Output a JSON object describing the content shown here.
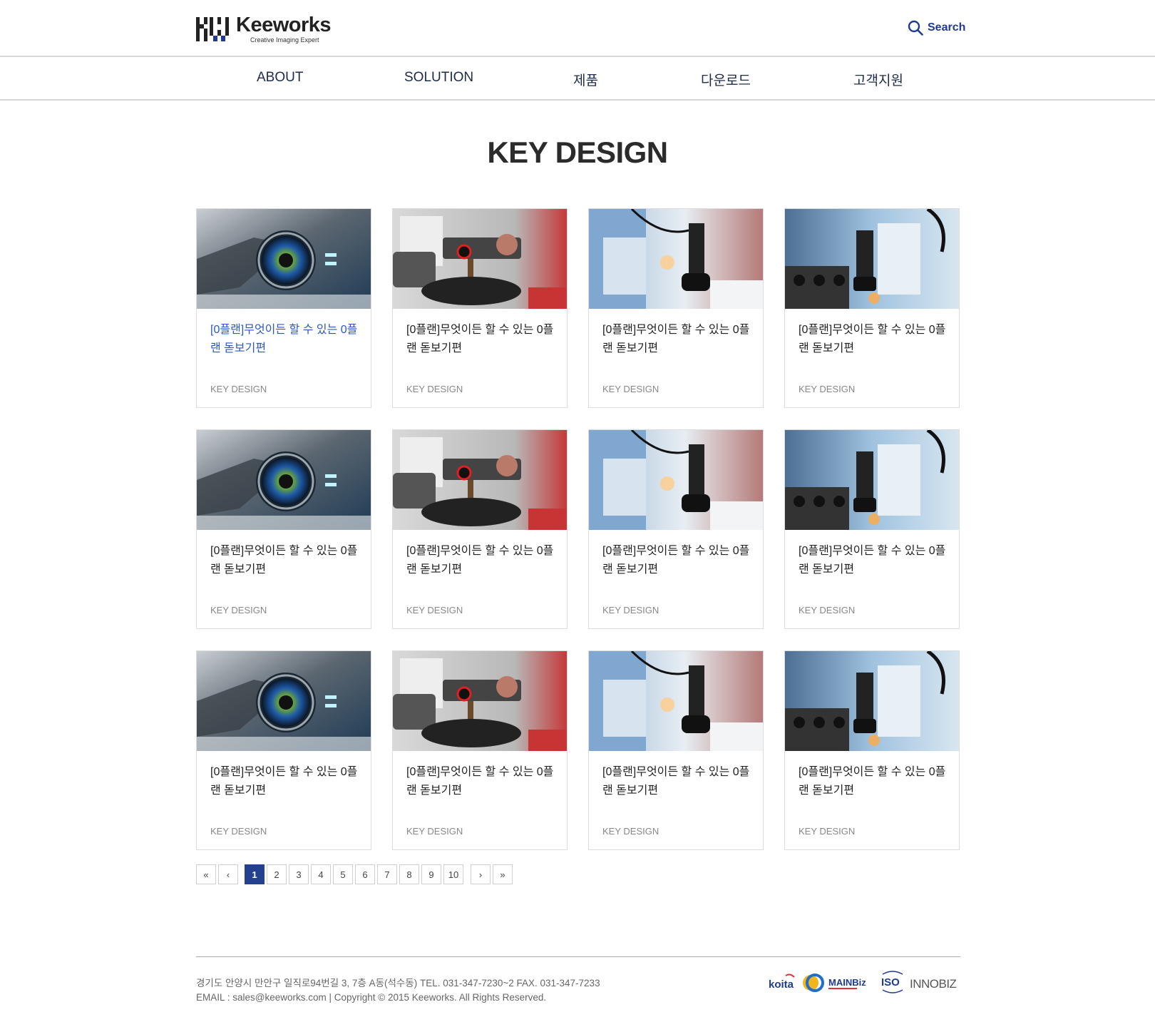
{
  "header": {
    "brand_name": "Keeworks",
    "brand_tagline": "Creative  Imaging  Expert",
    "search_label": "Search"
  },
  "nav": {
    "items": [
      {
        "label": "ABOUT"
      },
      {
        "label": "SOLUTION"
      },
      {
        "label": "제품"
      },
      {
        "label": "다운로드"
      },
      {
        "label": "고객지원"
      }
    ]
  },
  "main": {
    "page_title": "KEY DESIGN",
    "cards": [
      {
        "title": "[0플랜]무엇이든 할 수 있는 0플랜 돋보기편",
        "category": "KEY DESIGN",
        "image": "car-headlight-image",
        "active": true
      },
      {
        "title": "[0플랜]무엇이든 할 수 있는 0플랜 돋보기편",
        "category": "KEY DESIGN",
        "image": "inspection-machine-image"
      },
      {
        "title": "[0플랜]무엇이든 할 수 있는 0플랜 돋보기편",
        "category": "KEY DESIGN",
        "image": "industrial-camera-image"
      },
      {
        "title": "[0플랜]무엇이든 할 수 있는 0플랜 돋보기편",
        "category": "KEY DESIGN",
        "image": "factory-automation-image"
      },
      {
        "title": "[0플랜]무엇이든 할 수 있는 0플랜 돋보기편",
        "category": "KEY DESIGN",
        "image": "car-headlight-image"
      },
      {
        "title": "[0플랜]무엇이든 할 수 있는 0플랜 돋보기편",
        "category": "KEY DESIGN",
        "image": "inspection-machine-image"
      },
      {
        "title": "[0플랜]무엇이든 할 수 있는 0플랜 돋보기편",
        "category": "KEY DESIGN",
        "image": "industrial-camera-image"
      },
      {
        "title": "[0플랜]무엇이든 할 수 있는 0플랜 돋보기편",
        "category": "KEY DESIGN",
        "image": "factory-automation-image"
      },
      {
        "title": "[0플랜]무엇이든 할 수 있는 0플랜 돋보기편",
        "category": "KEY DESIGN",
        "image": "car-headlight-image"
      },
      {
        "title": "[0플랜]무엇이든 할 수 있는 0플랜 돋보기편",
        "category": "KEY DESIGN",
        "image": "inspection-machine-image"
      },
      {
        "title": "[0플랜]무엇이든 할 수 있는 0플랜 돋보기편",
        "category": "KEY DESIGN",
        "image": "industrial-camera-image"
      },
      {
        "title": "[0플랜]무엇이든 할 수 있는 0플랜 돋보기편",
        "category": "KEY DESIGN",
        "image": "factory-automation-image"
      }
    ]
  },
  "pagination": {
    "first": "«",
    "prev": "‹",
    "pages": [
      "1",
      "2",
      "3",
      "4",
      "5",
      "6",
      "7",
      "8",
      "9",
      "10"
    ],
    "current": "1",
    "next": "›",
    "last": "»"
  },
  "footer": {
    "address": "경기도 안양시 만안구 일직로94번길 3, 7층 A동(석수동)    TEL. 031-347-7230~2  FAX. 031-347-7233",
    "email_copyright": "EMAIL : sales@keeworks.com | Copyright © 2015 Keeworks. All Rights Reserved.",
    "badges": [
      {
        "name": "koita",
        "text": "koita",
        "color": "#1f3a93"
      },
      {
        "name": "venture-logo",
        "text": "",
        "color": "#f2b51c"
      },
      {
        "name": "mainbiz",
        "text": "MAINBiz",
        "color": "#1f3a93"
      },
      {
        "name": "iso",
        "text": "ISO",
        "color": "#1f3a93"
      },
      {
        "name": "innobiz",
        "text": "INNOBIZ",
        "color": "#555555"
      }
    ]
  },
  "colors": {
    "accent": "#24418f",
    "link_active": "#2b57c9",
    "nav_text": "#1c2b4a"
  }
}
